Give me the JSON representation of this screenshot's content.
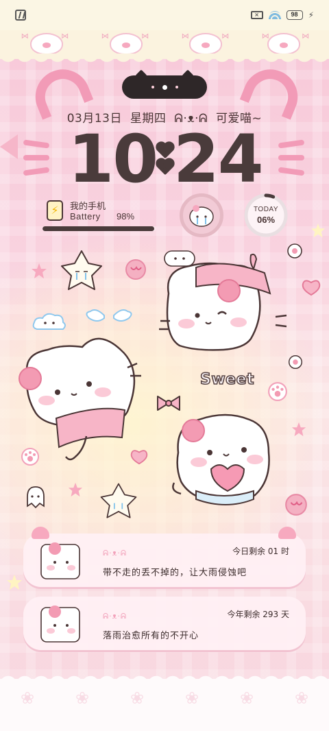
{
  "status_bar": {
    "battery_level": "98",
    "icons": [
      "nfc-icon",
      "sim-x-icon",
      "wifi-icon",
      "battery-icon",
      "charge-icon"
    ]
  },
  "lockscreen": {
    "date": "03月13日",
    "weekday": "星期四",
    "tagline": "可爱喵~",
    "clock_hours": "10",
    "clock_minutes": "24"
  },
  "battery_widget": {
    "device_name": "我的手机",
    "label": "Battery",
    "value": "98%",
    "level_percent": 98
  },
  "today_widget": {
    "label": "TODAY",
    "value": "06%",
    "progress_percent": 6
  },
  "stickers": {
    "sweet": "Sweet"
  },
  "notifications": [
    {
      "meta": "今日剩余 01 时",
      "message": "带不走的丢不掉的，让大雨侵蚀吧"
    },
    {
      "meta": "今年剩余 293 天",
      "message": "落雨治愈所有的不开心"
    }
  ],
  "colors": {
    "pink_accent": "#f29bb7",
    "dark_brown": "#4a3b3b",
    "cream": "#fbf3df",
    "background_pink": "#f7c8d8"
  }
}
